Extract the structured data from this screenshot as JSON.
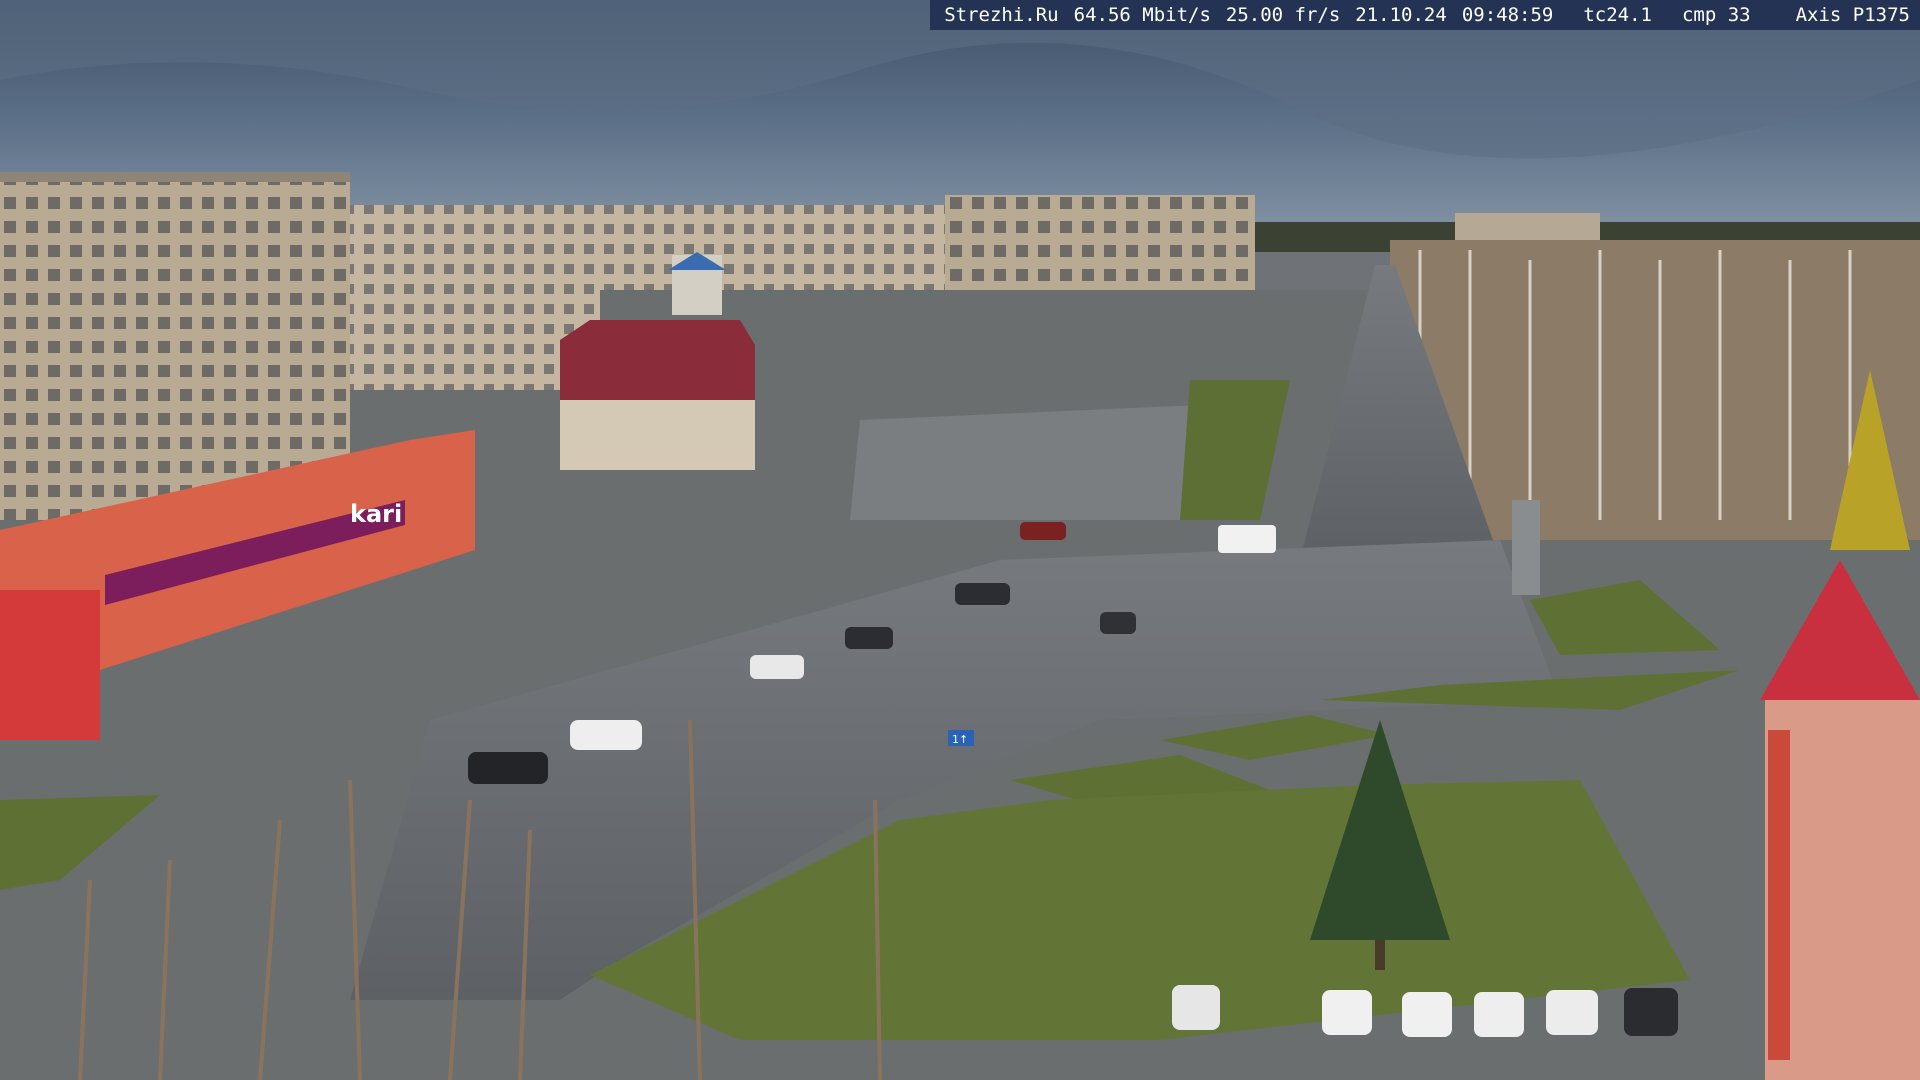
{
  "overlay": {
    "site": "Strezhi.Ru",
    "bitrate": "64.56 Mbit/s",
    "fps": "25.00 fr/s",
    "date": "21.10.24",
    "time": "09:48:59",
    "tc": "tc24.1",
    "cmp": "cmp 33",
    "camera": "Axis P1375"
  },
  "signs": {
    "store_name": "kari",
    "lane_sign": "1↑"
  },
  "colors": {
    "sky": "#4a5d72",
    "road": "#6c6f73",
    "grass": "#5f7238",
    "brick": "#d8624a",
    "kari_purple": "#7c1e5b"
  }
}
